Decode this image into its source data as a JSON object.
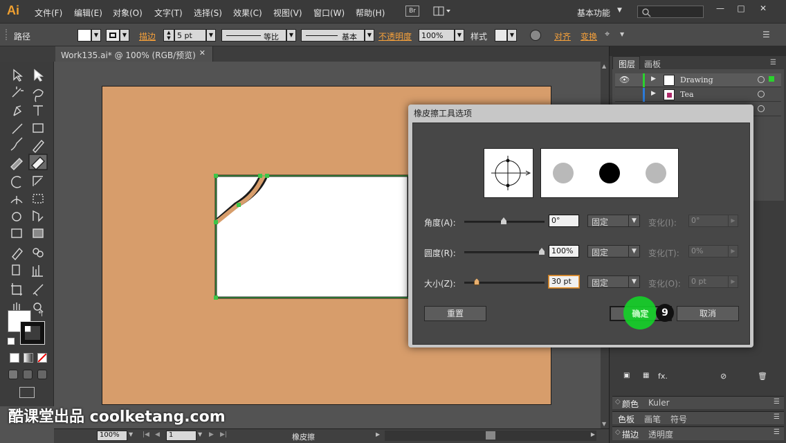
{
  "app": {
    "logo": "Ai",
    "workspace": "基本功能",
    "bridge": "Br"
  },
  "menu": [
    "文件(F)",
    "编辑(E)",
    "对象(O)",
    "文字(T)",
    "选择(S)",
    "效果(C)",
    "视图(V)",
    "窗口(W)",
    "帮助(H)"
  ],
  "control_bar": {
    "selection_label": "路径",
    "stroke_label": "描边",
    "stroke_weight": "5 pt",
    "profile_label": "等比",
    "brush_label": "基本",
    "opacity_label": "不透明度",
    "opacity_value": "100%",
    "style_label": "样式",
    "align_label": "对齐",
    "transform_label": "变换"
  },
  "document": {
    "tab_title": "Work135.ai* @ 100% (RGB/预览)",
    "close": "✕"
  },
  "layers_panel": {
    "tabs": [
      "图层",
      "画板"
    ],
    "layers": [
      {
        "name": "Drawing"
      },
      {
        "name": "Tea"
      }
    ]
  },
  "bottom_panels": {
    "row1": [
      "颜色",
      "Kuler"
    ],
    "row2": [
      "色板",
      "画笔",
      "符号"
    ],
    "row3": [
      "描边",
      "透明度"
    ]
  },
  "status": {
    "zoom": "100%",
    "page": "1",
    "tool_name": "橡皮擦"
  },
  "dialog": {
    "title": "橡皮擦工具选项",
    "angle": {
      "label": "角度(A):",
      "value": "0°",
      "mode": "固定",
      "var_label": "变化(I):",
      "var_value": "0°"
    },
    "roundness": {
      "label": "圆度(R):",
      "value": "100%",
      "mode": "固定",
      "var_label": "变化(T):",
      "var_value": "0%"
    },
    "size": {
      "label": "大小(Z):",
      "value": "30 pt",
      "mode": "固定",
      "var_label": "变化(O):",
      "var_value": "0 pt"
    },
    "reset_button": "重置",
    "ok_button": "确定",
    "cancel_button": "取消",
    "step_badge": "9"
  },
  "watermark": "酷课堂出品 coolketang.com",
  "colors": {
    "accent_orange": "#f7a13a",
    "artboard": "#d79d6b",
    "click_green": "#1fd12d"
  }
}
